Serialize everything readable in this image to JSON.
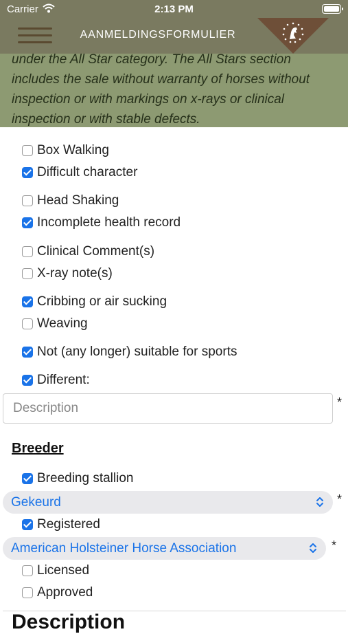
{
  "status_bar": {
    "carrier": "Carrier",
    "time": "2:13 PM"
  },
  "navbar": {
    "title": "AANMELDINGSFORMULIER"
  },
  "banner": {
    "text": "under the All Star category. The All Stars section includes the sale without warranty of horses without inspection or with markings on x-rays or clinical inspection or with stable defects."
  },
  "defects": [
    {
      "label": "Box Walking",
      "checked": false
    },
    {
      "label": "Difficult character",
      "checked": true
    },
    {
      "label": "Head Shaking",
      "checked": false
    },
    {
      "label": "Incomplete health record",
      "checked": true
    },
    {
      "label": "Clinical Comment(s)",
      "checked": false
    },
    {
      "label": "X-ray note(s)",
      "checked": false
    },
    {
      "label": "Cribbing or air sucking",
      "checked": true
    },
    {
      "label": "Weaving",
      "checked": false
    },
    {
      "label": "Not (any longer) suitable for sports",
      "checked": true
    },
    {
      "label": "Different:",
      "checked": true
    }
  ],
  "description": {
    "placeholder": "Description",
    "required_marker": "*"
  },
  "breeder": {
    "title": "Breeder",
    "breeding_stallion": {
      "label": "Breeding stallion",
      "checked": true
    },
    "status_select": {
      "value": "Gekeurd",
      "required_marker": "*"
    },
    "registered": {
      "label": "Registered",
      "checked": true
    },
    "association_select": {
      "value": "American Holsteiner Horse Association",
      "required_marker": "*"
    },
    "licensed": {
      "label": "Licensed",
      "checked": false
    },
    "approved": {
      "label": "Approved",
      "checked": false
    }
  },
  "next_section": {
    "title": "Description"
  },
  "colors": {
    "header": "#7a7a60",
    "banner": "#8d9a72",
    "accent": "#1a73e8"
  }
}
